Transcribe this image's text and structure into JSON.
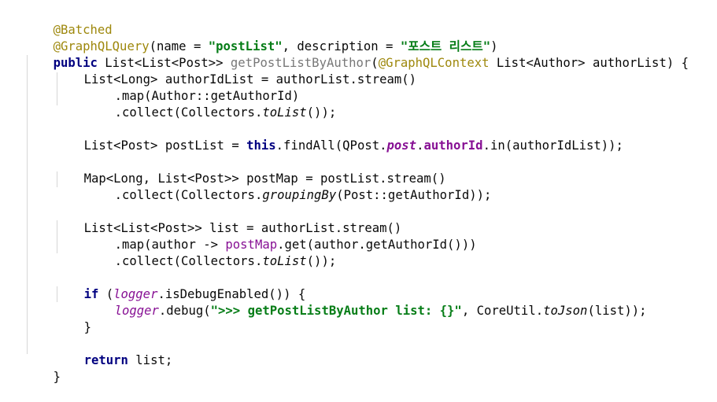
{
  "code": {
    "l1": {
      "anno": "@Batched"
    },
    "l2": {
      "anno": "@GraphQLQuery",
      "open": "(name = ",
      "name_val": "\"postList\"",
      "mid": ", description = ",
      "desc_val": "\"포스트 리스트\"",
      "close": ")"
    },
    "l3": {
      "kw_public": "public",
      "ret_type": " List<List<Post>> ",
      "method": "getPostListByAuthor",
      "open": "(",
      "param_anno": "@GraphQLContext",
      "params": " List<Author> authorList) {"
    },
    "l4": {
      "text": "List<Long> authorIdList = authorList.stream()"
    },
    "l5": {
      "text": ".map(Author::getAuthorId)"
    },
    "l6": {
      "pre": ".collect(Collectors.",
      "method": "toList",
      "post": "());"
    },
    "l7": {
      "pre": "List<Post> postList = ",
      "kw_this": "this",
      "mid": ".findAll(QPost.",
      "static_post": "post",
      "dot": ".",
      "field": "authorId",
      "post": ".in(authorIdList));"
    },
    "l8": {
      "text": "Map<Long, List<Post>> postMap = postList.stream()"
    },
    "l9": {
      "pre": ".collect(Collectors.",
      "method": "groupingBy",
      "post": "(Post::getAuthorId));"
    },
    "l10": {
      "text": "List<List<Post>> list = authorList.stream()"
    },
    "l11": {
      "pre": ".map(author -> ",
      "field": "postMap",
      "post": ".get(author.getAuthorId()))"
    },
    "l12": {
      "pre": ".collect(Collectors.",
      "method": "toList",
      "post": "());"
    },
    "l13": {
      "kw_if": "if",
      "open": " (",
      "field": "logger",
      "post": ".isDebugEnabled()) {"
    },
    "l14": {
      "field": "logger",
      "mid": ".debug(",
      "str": "\">>> getPostListByAuthor list: {}\"",
      "pre_call": ", CoreUtil.",
      "method": "toJson",
      "post": "(list));"
    },
    "l15": {
      "text": "}"
    },
    "l16": {
      "kw_return": "return",
      "post": " list;"
    },
    "l17": {
      "text": "}"
    }
  }
}
